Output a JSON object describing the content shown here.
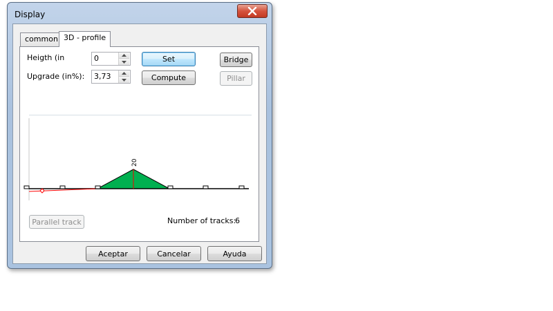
{
  "window": {
    "title": "Display"
  },
  "tabs": [
    {
      "label": "common",
      "active": false
    },
    {
      "label": "3D - profile",
      "active": true
    }
  ],
  "height_field": {
    "label": "Heigth (in",
    "value": "0"
  },
  "upgrade_field": {
    "label": "Upgrade (in%):",
    "value": "3,73"
  },
  "buttons": {
    "set": "Set",
    "compute": "Compute",
    "bridge": "Bridge",
    "pillar": "Pillar",
    "parallel_track": "Parallel track"
  },
  "tracks": {
    "label": "Number of tracks:",
    "value": "6"
  },
  "footer": {
    "accept": "Aceptar",
    "cancel": "Cancelar",
    "help": "Ayuda"
  },
  "profile": {
    "peak_label": "20",
    "fill_color": "#00b050",
    "line_color": "#ff0000",
    "axis_color": "#000000"
  }
}
